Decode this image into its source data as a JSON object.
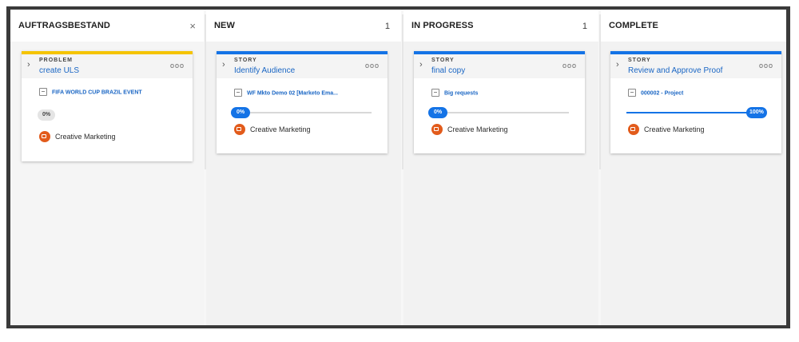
{
  "columns": [
    {
      "title": "AUFTRAGSBESTAND",
      "close_glyph": "×",
      "card": {
        "type": "PROBLEM",
        "name": "create ULS",
        "project": "FIFA WORLD CUP BRAZIL EVENT",
        "progress": 0,
        "progress_label": "0%",
        "team": "Creative Marketing",
        "accent": "#f5c400"
      }
    },
    {
      "title": "NEW",
      "count": "1",
      "card": {
        "type": "STORY",
        "name": "Identify Audience",
        "project": "WF Mkto Demo 02 [Marketo Ema...",
        "progress": 0,
        "progress_label": "0%",
        "team": "Creative Marketing",
        "accent": "#1473e6"
      }
    },
    {
      "title": "IN PROGRESS",
      "count": "1",
      "card": {
        "type": "STORY",
        "name": "final copy",
        "project": "Big requests",
        "progress": 0,
        "progress_label": "0%",
        "team": "Creative Marketing",
        "accent": "#1473e6"
      }
    },
    {
      "title": "COMPLETE",
      "card": {
        "type": "STORY",
        "name": "Review and Approve Proof",
        "project": "000002 - Project",
        "progress": 100,
        "progress_label": "100%",
        "team": "Creative Marketing",
        "accent": "#1473e6"
      }
    }
  ],
  "icons": {
    "expand": "chevron-right-icon",
    "more": "more-options-icon",
    "project": "project-icon",
    "team": "team-icon",
    "close": "close-icon"
  },
  "more_glyph": "ooo",
  "chevron_glyph": "›"
}
